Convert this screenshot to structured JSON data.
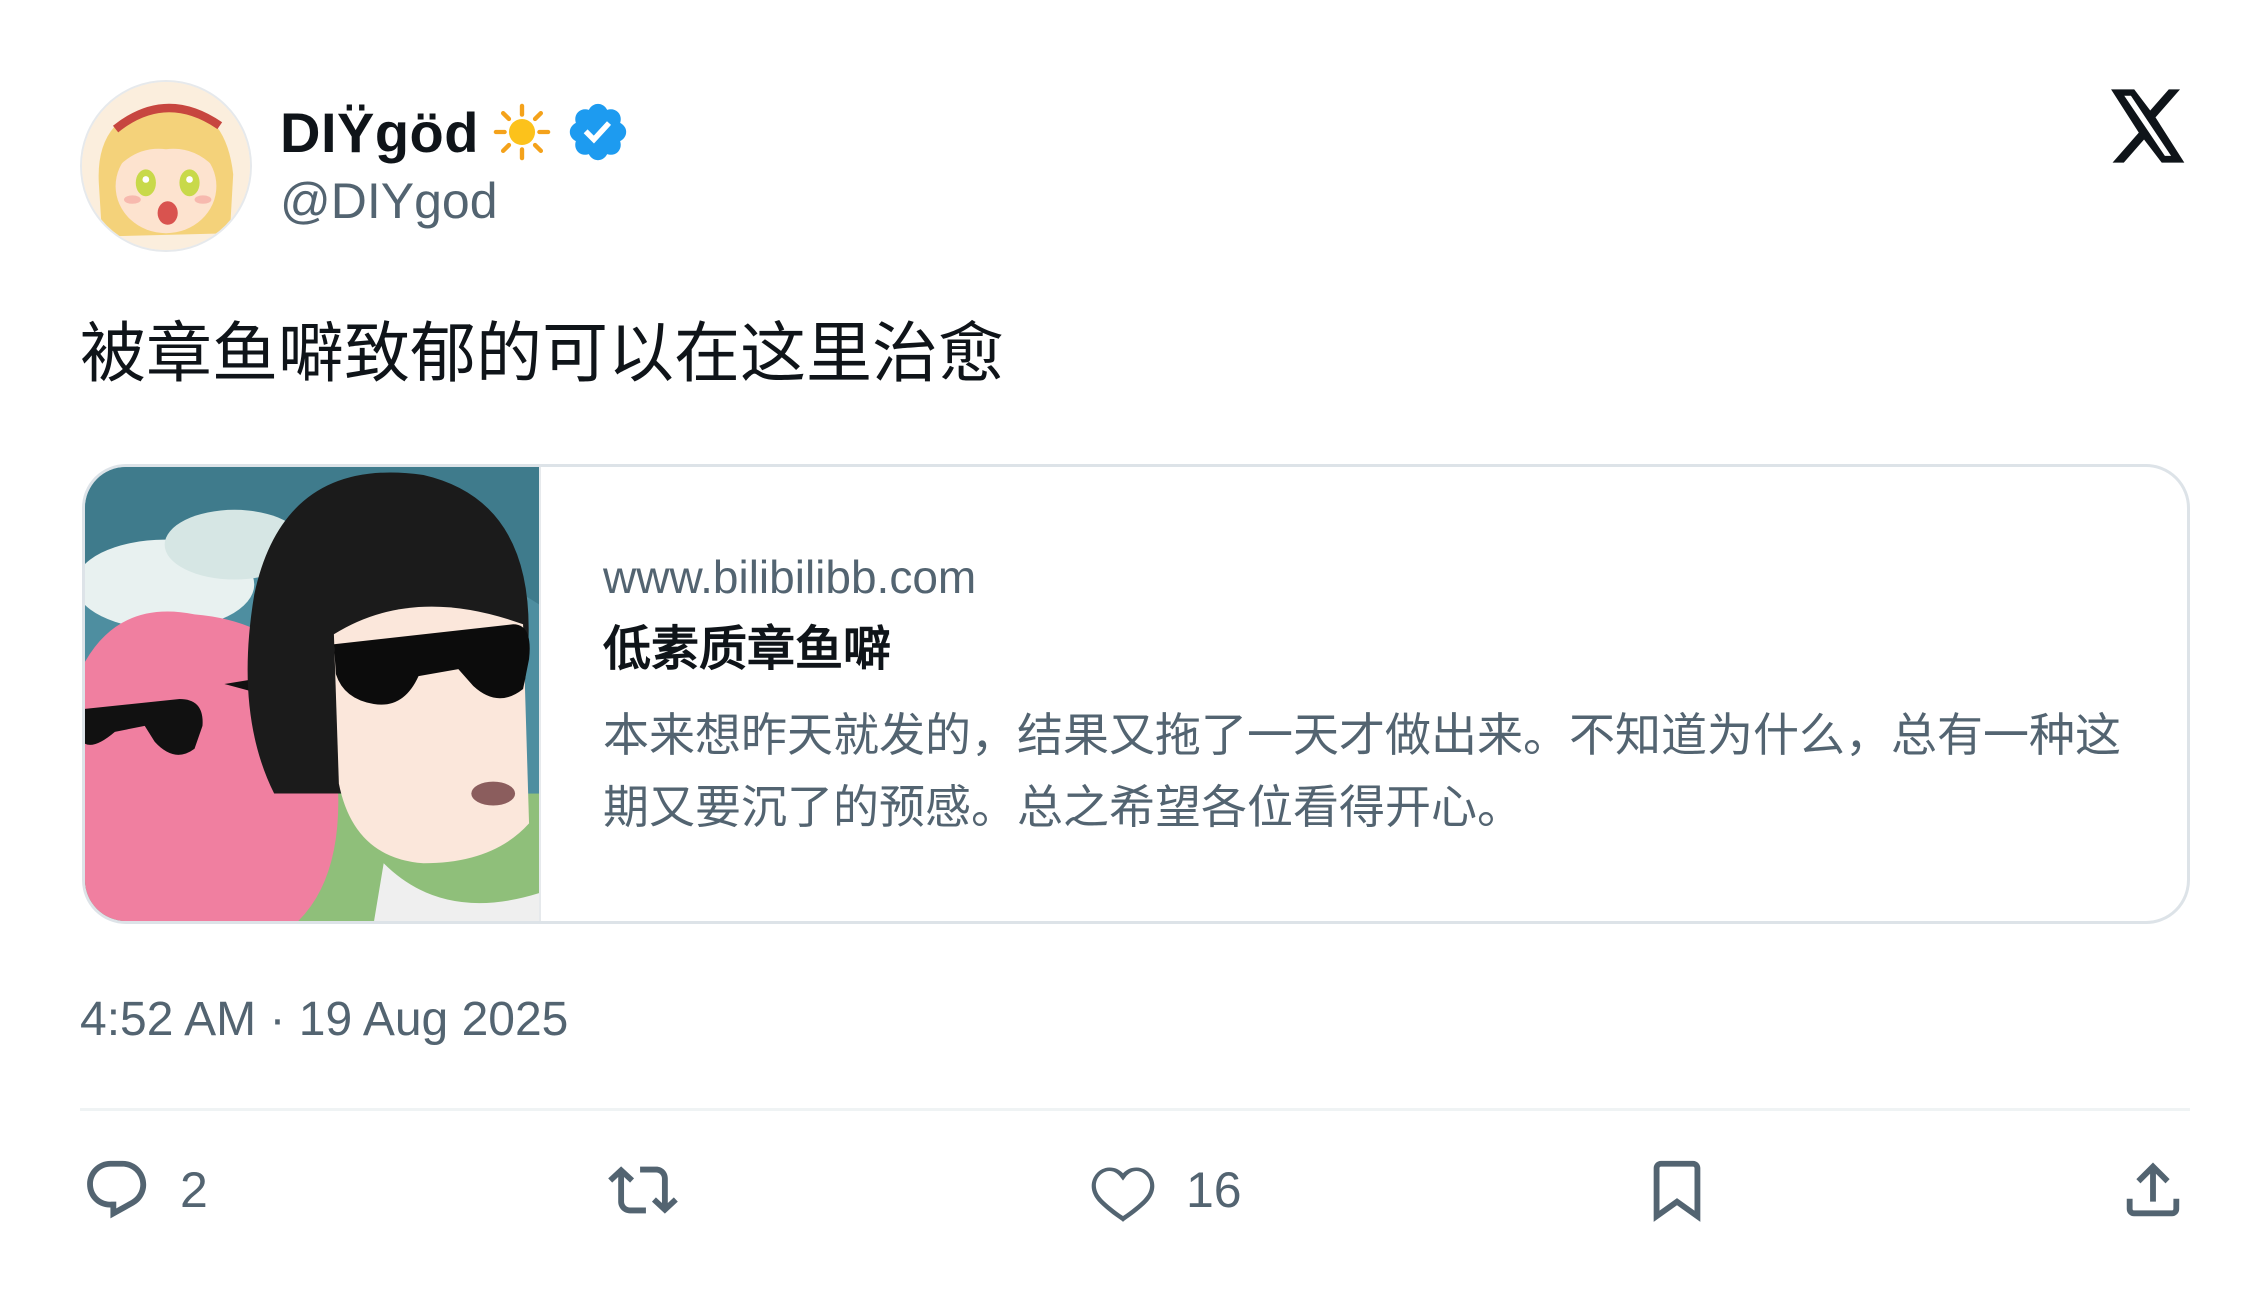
{
  "author": {
    "display_name": "DIŸgöd",
    "handle": "@DIYgod",
    "avatar_icon": "anime-avatar",
    "emoji_icon": "sun-icon",
    "verified_icon": "verified-badge-icon",
    "verified_color": "#1d9bf0"
  },
  "platform_logo": "x-logo",
  "tweet_text": "被章鱼噼致郁的可以在这里治愈",
  "link_card": {
    "domain": "www.bilibilibb.com",
    "title": "低素质章鱼噼",
    "description": "本来想昨天就发的，结果又拖了一天才做出来。不知道为什么，总有一种这期又要沉了的预感。总之希望各位看得开心。",
    "thumbnail_icon": "anime-thumbnail"
  },
  "timestamp": "4:52 AM · 19 Aug 2025",
  "actions": {
    "reply_count": "2",
    "retweet_count": "",
    "like_count": "16",
    "reply_icon": "reply-icon",
    "retweet_icon": "retweet-icon",
    "like_icon": "heart-icon",
    "bookmark_icon": "bookmark-icon",
    "share_icon": "share-icon"
  },
  "colors": {
    "text_primary": "#0f1419",
    "text_secondary": "#536471",
    "border": "#dde3e8"
  }
}
